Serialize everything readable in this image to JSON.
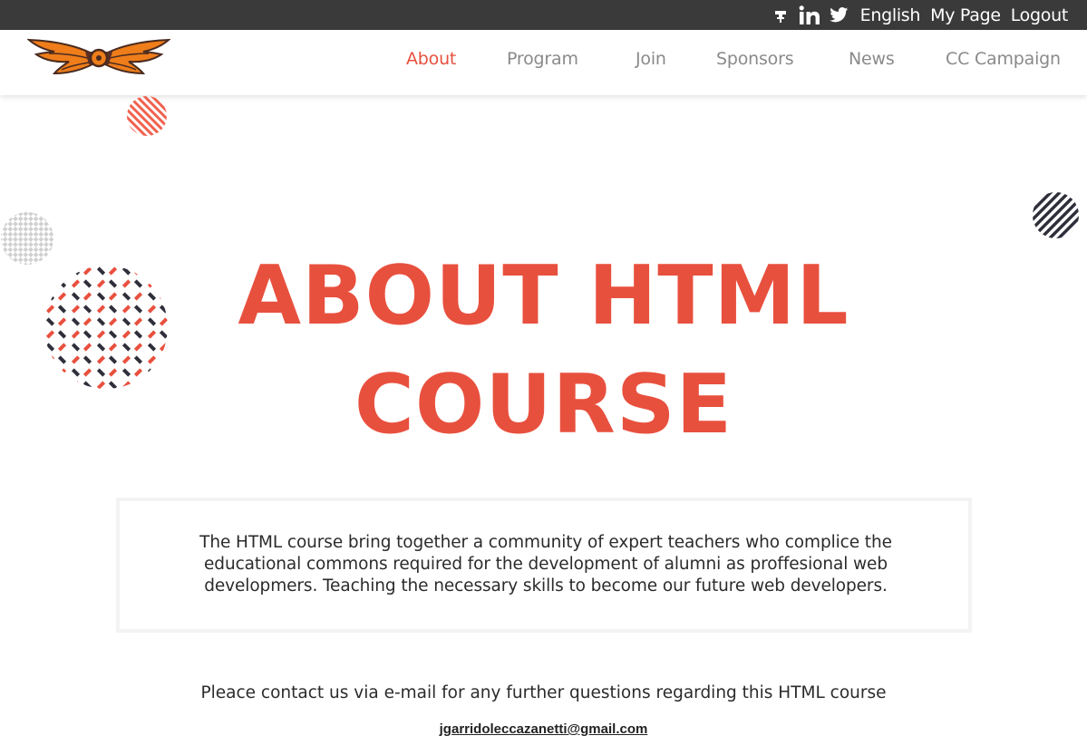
{
  "topbar": {
    "icons": [
      "github-icon",
      "linkedin-icon",
      "twitter-icon"
    ],
    "language": "English",
    "my_page": "My Page",
    "logout": "Logout"
  },
  "nav": {
    "logo": "winged-logo",
    "items": [
      {
        "label": "About",
        "active": true
      },
      {
        "label": "Program",
        "active": false
      },
      {
        "label": "Join",
        "active": false
      },
      {
        "label": "Sponsors",
        "active": false
      },
      {
        "label": "News",
        "active": false
      },
      {
        "label": "CC Campaign",
        "active": false
      }
    ]
  },
  "hero": {
    "title_line1": "ABOUT HTML",
    "title_line2": "COURSE"
  },
  "intro": {
    "text": "The HTML course bring together a community of expert teachers who complice the educational commons required for the development of alumni as proffesional web developmers. Teaching the necessary skills to become our future web developers."
  },
  "contact": {
    "text": "Pleace contact us via e-mail for any further questions regarding this HTML course",
    "email": "jgarridoleccazanetti@gmail.com"
  },
  "colors": {
    "accent": "#e8503e",
    "topbar_bg": "#3a3a3a",
    "nav_text": "#8a8a8a",
    "dark_pattern": "#2e2f3a"
  }
}
